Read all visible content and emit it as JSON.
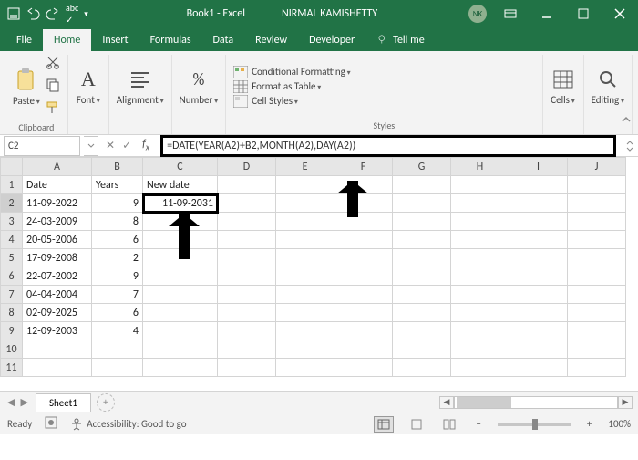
{
  "title": {
    "doc": "Book1  -  Excel",
    "user": "NIRMAL KAMISHETTY",
    "initials": "NK"
  },
  "tabs": {
    "file": "File",
    "home": "Home",
    "insert": "Insert",
    "formulas": "Formulas",
    "data": "Data",
    "review": "Review",
    "developer": "Developer",
    "tellme": "Tell me"
  },
  "ribbon": {
    "paste": "Paste",
    "clipboard": "Clipboard",
    "font": "Font",
    "alignment": "Alignment",
    "number": "Number",
    "cond": "Conditional Formatting",
    "table": "Format as Table",
    "cellstyles": "Cell Styles",
    "styles": "Styles",
    "cells": "Cells",
    "editing": "Editing"
  },
  "fx": {
    "cellref": "C2",
    "formula": "=DATE(YEAR(A2)+B2,MONTH(A2),DAY(A2))"
  },
  "headers": {
    "A": "A",
    "B": "B",
    "C": "C",
    "D": "D",
    "E": "E",
    "F": "F",
    "G": "G",
    "H": "H",
    "I": "I",
    "J": "J"
  },
  "cols": {
    "date": "Date",
    "years": "Years",
    "newdate": "New date"
  },
  "rows": [
    {
      "date": "11-09-2022",
      "years": "9",
      "newdate": "11-09-2031"
    },
    {
      "date": "24-03-2009",
      "years": "8",
      "newdate": ""
    },
    {
      "date": "20-05-2006",
      "years": "6",
      "newdate": ""
    },
    {
      "date": "17-09-2008",
      "years": "2",
      "newdate": ""
    },
    {
      "date": "22-07-2002",
      "years": "9",
      "newdate": ""
    },
    {
      "date": "04-04-2004",
      "years": "7",
      "newdate": ""
    },
    {
      "date": "02-09-2025",
      "years": "6",
      "newdate": ""
    },
    {
      "date": "12-09-2003",
      "years": "4",
      "newdate": ""
    }
  ],
  "rowLabels": {
    "r1": "1",
    "r2": "2",
    "r3": "3",
    "r4": "4",
    "r5": "5",
    "r6": "6",
    "r7": "7",
    "r8": "8",
    "r9": "9",
    "r10": "10",
    "r11": "11"
  },
  "sheet": {
    "name": "Sheet1"
  },
  "status": {
    "ready": "Ready",
    "access": "Accessibility: Good to go",
    "zoom": "100%"
  }
}
